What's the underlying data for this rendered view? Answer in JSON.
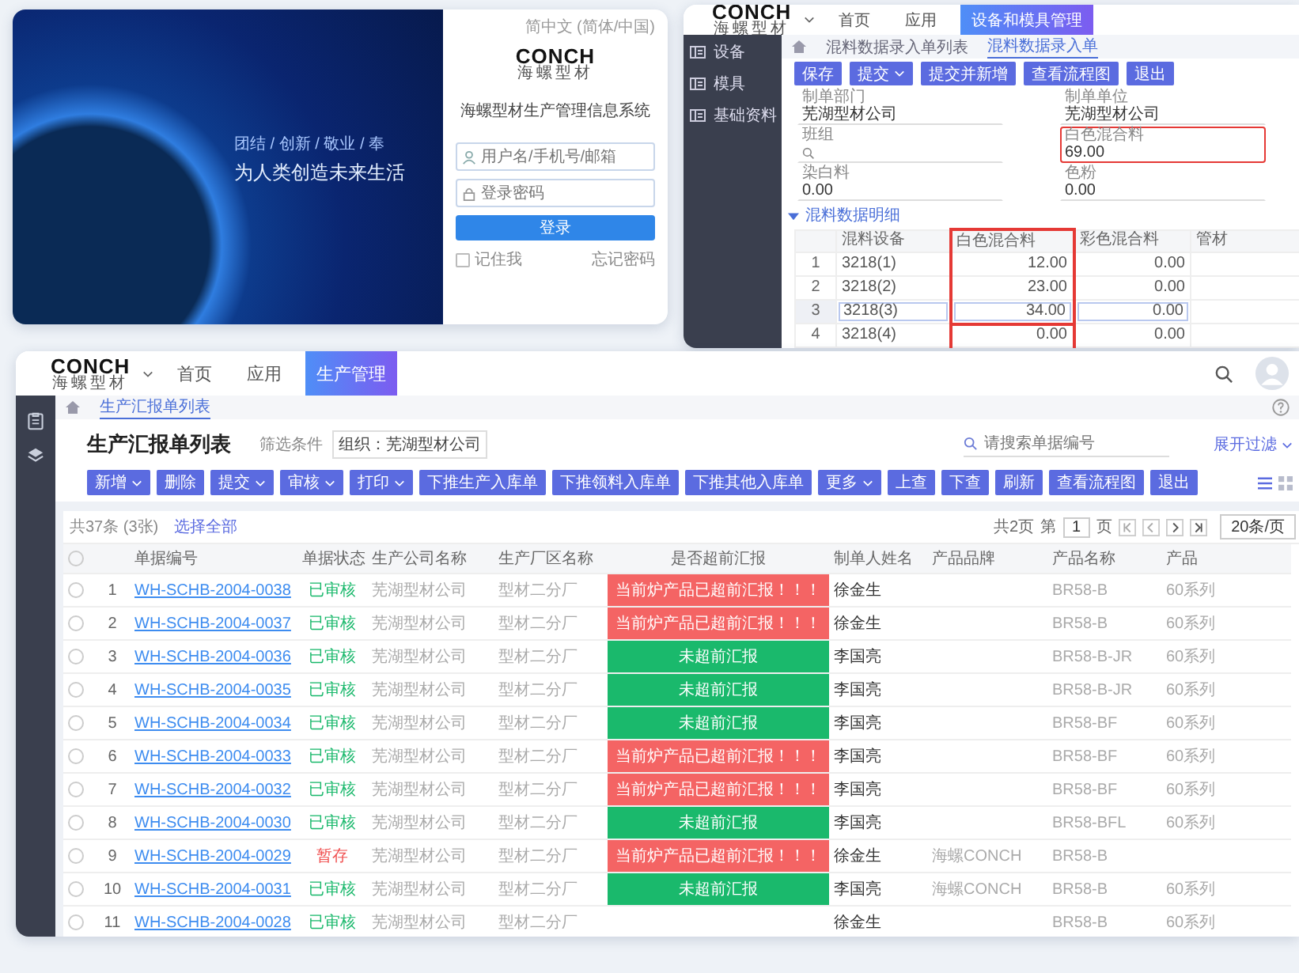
{
  "login_window": {
    "background_slogan": [
      "团结 / 创新 / 敬业 / 奉",
      "为人类创造未来生活"
    ],
    "language": "简中文 (简体/中国)",
    "logo": "CONCH",
    "logo_subtitle": "海螺型材",
    "system_title": "海螺型材生产管理信息系统",
    "username_field": {
      "placeholder": "用户名/手机号/邮箱"
    },
    "password_field": {
      "placeholder": "登录密码"
    },
    "login_button": "登录",
    "remember": {
      "label": "记住我",
      "checked": false
    },
    "forgot_link": "忘记密码"
  },
  "mixing_window": {
    "logo": "CONCH",
    "logo_subtitle": "海螺型材",
    "nav": [
      {
        "label": "首页",
        "selected": false
      },
      {
        "label": "应用",
        "selected": false
      },
      {
        "label": "设备和模具管理",
        "selected": true
      }
    ],
    "sidebar": [
      {
        "label": "设备"
      },
      {
        "label": "模具"
      },
      {
        "label": "基础资料"
      }
    ],
    "tabs": [
      {
        "label": "混料数据录入单列表",
        "selected": false
      },
      {
        "label": "混料数据录入单",
        "selected": true
      }
    ],
    "buttons": [
      {
        "label": "保存",
        "dropdown": false
      },
      {
        "label": "提交",
        "dropdown": true
      },
      {
        "label": "提交并新增",
        "dropdown": false
      },
      {
        "label": "查看流程图",
        "dropdown": false
      },
      {
        "label": "退出",
        "dropdown": false
      }
    ],
    "fields": [
      {
        "label": "制单部门",
        "value": "芜湖型材公司",
        "kind": "text",
        "highlighted": false
      },
      {
        "label": "制单单位",
        "value": "芜湖型材公司",
        "kind": "text",
        "highlighted": false
      },
      {
        "label": "班组",
        "kind": "search",
        "highlighted": false
      },
      {
        "label": "白色混合料",
        "value": "69.00",
        "kind": "text",
        "highlighted": true
      },
      {
        "label": "染白料",
        "value": "0.00",
        "kind": "text",
        "highlighted": false
      },
      {
        "label": "色粉",
        "value": "0.00",
        "kind": "text",
        "highlighted": false
      }
    ],
    "section": {
      "title": "混料数据明细",
      "expanded": true
    },
    "detail_table": {
      "columns": [
        {
          "label": "混料设备",
          "highlighted": false
        },
        {
          "label": "白色混合料",
          "highlighted": true
        },
        {
          "label": "彩色混合料",
          "highlighted": false
        },
        {
          "label": "管材",
          "highlighted": false
        }
      ],
      "rows": [
        {
          "index": "1",
          "cells": [
            "3218(1)",
            "12.00",
            "0.00"
          ],
          "selected": false
        },
        {
          "index": "2",
          "cells": [
            "3218(2)",
            "23.00",
            "0.00"
          ],
          "selected": false
        },
        {
          "index": "3",
          "cells": [
            "3218(3)",
            "34.00",
            "0.00"
          ],
          "selected": true
        },
        {
          "index": "4",
          "cells": [
            "3218(4)",
            "0.00",
            "0.00"
          ],
          "selected": false
        }
      ]
    }
  },
  "production_window": {
    "logo": "CONCH",
    "logo_subtitle": "海螺型材",
    "nav": [
      {
        "label": "首页",
        "selected": false
      },
      {
        "label": "应用",
        "selected": false
      },
      {
        "label": "生产管理",
        "selected": true
      }
    ],
    "sidebar": [
      {
        "kind": "clipboard"
      },
      {
        "kind": "layers"
      }
    ],
    "tabs": [
      {
        "label": "生产汇报单列表",
        "selected": true
      }
    ],
    "title": "生产汇报单列表",
    "filter_label": "筛选条件",
    "filter_chip": "组织：芜湖型材公司",
    "search": {
      "placeholder": "请搜索单据编号"
    },
    "expand_filter": "展开过滤",
    "view_modes": [
      {
        "kind": "list",
        "selected": true
      },
      {
        "kind": "grid",
        "selected": false
      }
    ],
    "buttons": [
      {
        "label": "新增",
        "dropdown": true
      },
      {
        "label": "删除",
        "dropdown": false
      },
      {
        "label": "提交",
        "dropdown": true
      },
      {
        "label": "审核",
        "dropdown": true
      },
      {
        "label": "打印",
        "dropdown": true
      },
      {
        "label": "下推生产入库单",
        "dropdown": false
      },
      {
        "label": "下推领料入库单",
        "dropdown": false
      },
      {
        "label": "下推其他入库单",
        "dropdown": false
      },
      {
        "label": "更多",
        "dropdown": true
      },
      {
        "label": "上查",
        "dropdown": false
      },
      {
        "label": "下查",
        "dropdown": false
      },
      {
        "label": "刷新",
        "dropdown": false
      },
      {
        "label": "查看流程图",
        "dropdown": false
      },
      {
        "label": "退出",
        "dropdown": false
      }
    ],
    "total": "共37条 (3张)",
    "select_all": "选择全部",
    "pager": {
      "pages": "共2页",
      "before": "第",
      "page": "1",
      "after": "页",
      "page_size": "20条/页"
    },
    "table": {
      "header_checked": false,
      "columns": [
        "单据编号",
        "单据状态",
        "生产公司名称",
        "生产厂区名称",
        "是否超前汇报",
        "制单人姓名",
        "产品品牌",
        "产品名称",
        "产品"
      ],
      "rows": [
        {
          "index": "1",
          "checked": false,
          "code": "WH-SCHB-2004-0038",
          "status": "已审核",
          "approved": true,
          "company": "芜湖型材公司",
          "factory": "型材二分厂",
          "advance": "当前炉产品已超前汇报！！！",
          "early": true,
          "maker": "徐金生",
          "product": "BR58-B",
          "series": "60系列"
        },
        {
          "index": "2",
          "checked": false,
          "code": "WH-SCHB-2004-0037",
          "status": "已审核",
          "approved": true,
          "company": "芜湖型材公司",
          "factory": "型材二分厂",
          "advance": "当前炉产品已超前汇报！！！",
          "early": true,
          "maker": "徐金生",
          "product": "BR58-B",
          "series": "60系列"
        },
        {
          "index": "3",
          "checked": false,
          "code": "WH-SCHB-2004-0036",
          "status": "已审核",
          "approved": true,
          "company": "芜湖型材公司",
          "factory": "型材二分厂",
          "advance": "未超前汇报",
          "early": false,
          "maker": "李国亮",
          "product": "BR58-B-JR",
          "series": "60系列"
        },
        {
          "index": "4",
          "checked": false,
          "code": "WH-SCHB-2004-0035",
          "status": "已审核",
          "approved": true,
          "company": "芜湖型材公司",
          "factory": "型材二分厂",
          "advance": "未超前汇报",
          "early": false,
          "maker": "李国亮",
          "product": "BR58-B-JR",
          "series": "60系列"
        },
        {
          "index": "5",
          "checked": false,
          "code": "WH-SCHB-2004-0034",
          "status": "已审核",
          "approved": true,
          "company": "芜湖型材公司",
          "factory": "型材二分厂",
          "advance": "未超前汇报",
          "early": false,
          "maker": "李国亮",
          "product": "BR58-BF",
          "series": "60系列"
        },
        {
          "index": "6",
          "checked": false,
          "code": "WH-SCHB-2004-0033",
          "status": "已审核",
          "approved": true,
          "company": "芜湖型材公司",
          "factory": "型材二分厂",
          "advance": "当前炉产品已超前汇报！！！",
          "early": true,
          "maker": "李国亮",
          "product": "BR58-BF",
          "series": "60系列"
        },
        {
          "index": "7",
          "checked": false,
          "code": "WH-SCHB-2004-0032",
          "status": "已审核",
          "approved": true,
          "company": "芜湖型材公司",
          "factory": "型材二分厂",
          "advance": "当前炉产品已超前汇报！！！",
          "early": true,
          "maker": "李国亮",
          "product": "BR58-BF",
          "series": "60系列"
        },
        {
          "index": "8",
          "checked": false,
          "code": "WH-SCHB-2004-0030",
          "status": "已审核",
          "approved": true,
          "company": "芜湖型材公司",
          "factory": "型材二分厂",
          "advance": "未超前汇报",
          "early": false,
          "maker": "李国亮",
          "product": "BR58-BFL",
          "series": "60系列"
        },
        {
          "index": "9",
          "checked": false,
          "code": "WH-SCHB-2004-0029",
          "status": "暂存",
          "approved": false,
          "company": "芜湖型材公司",
          "factory": "型材二分厂",
          "advance": "当前炉产品已超前汇报！！！",
          "early": true,
          "maker": "徐金生",
          "brand": "海螺CONCH",
          "product": "BR58-B"
        },
        {
          "index": "10",
          "checked": false,
          "code": "WH-SCHB-2004-0031",
          "status": "已审核",
          "approved": true,
          "company": "芜湖型材公司",
          "factory": "型材二分厂",
          "advance": "未超前汇报",
          "early": false,
          "maker": "李国亮",
          "brand": "海螺CONCH",
          "product": "BR58-B",
          "series": "60系列"
        },
        {
          "index": "11",
          "checked": false,
          "code": "WH-SCHB-2004-0028",
          "status": "已审核",
          "approved": true,
          "company": "芜湖型材公司",
          "factory": "型材二分厂",
          "early": false,
          "maker": "徐金生",
          "product": "BR58-B",
          "series": "60系列"
        }
      ]
    }
  }
}
